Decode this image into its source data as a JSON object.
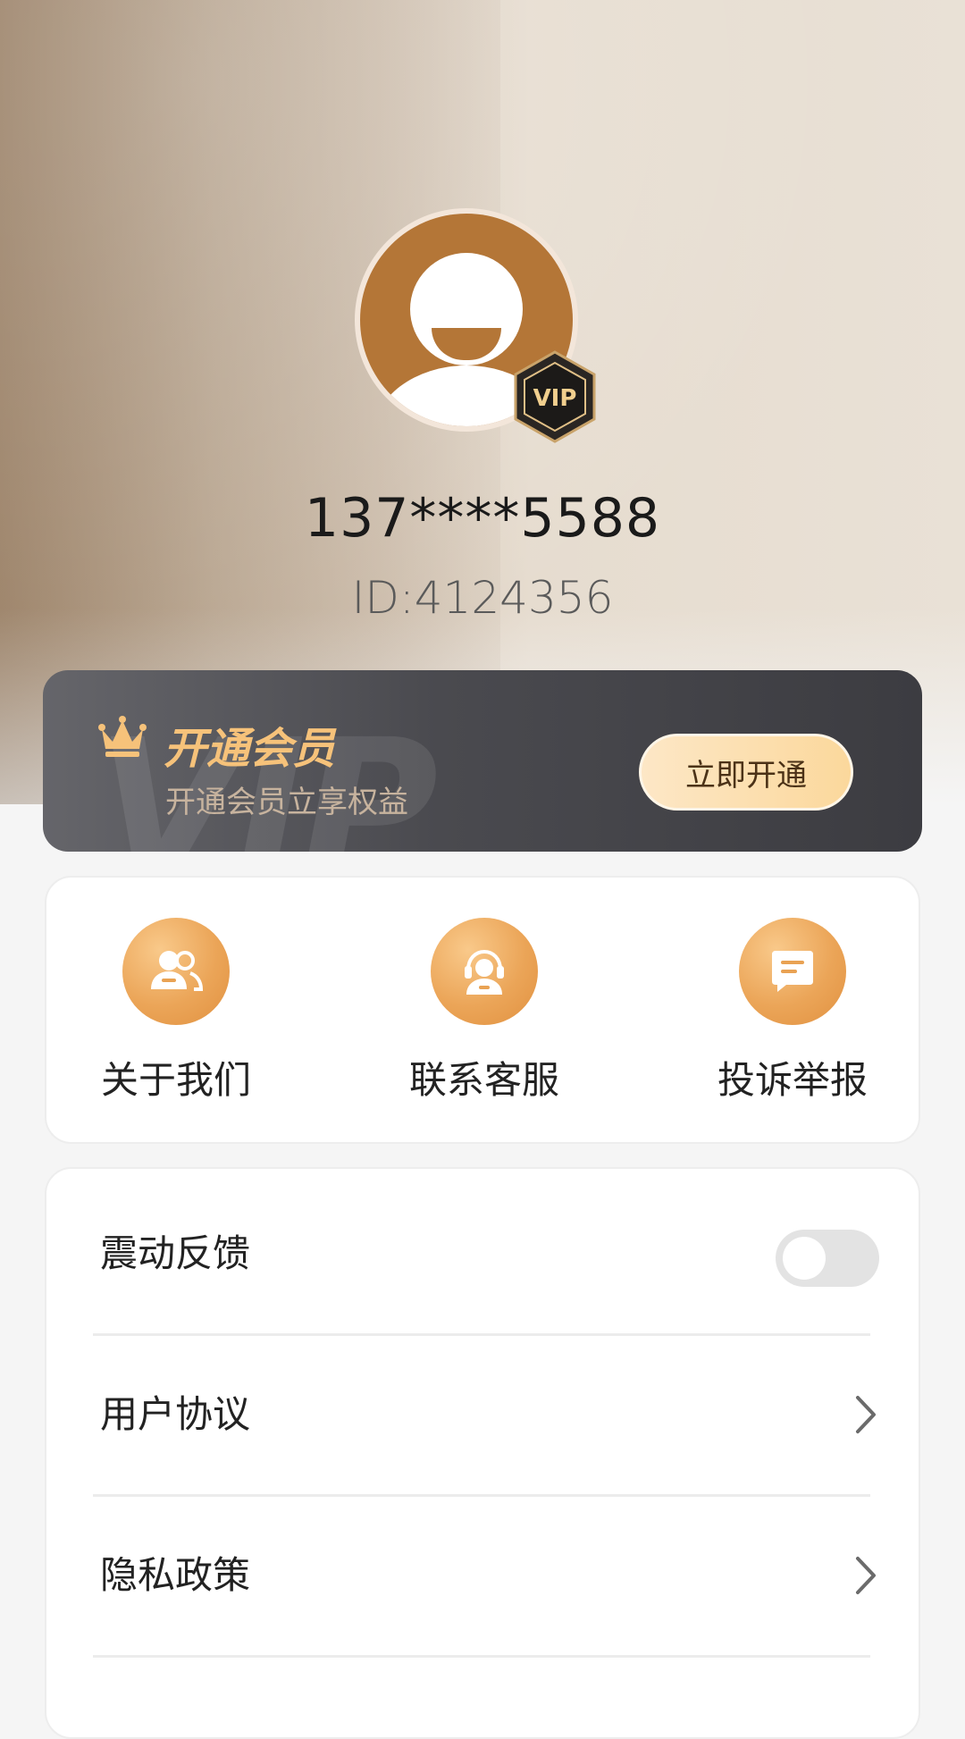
{
  "profile": {
    "phone": "137****5588",
    "id": "ID:4124356",
    "badge": "VIP"
  },
  "vip_banner": {
    "watermark": "VIP",
    "title": "开通会员",
    "subtitle": "开通会员立享权益",
    "button": "立即开通"
  },
  "actions": [
    {
      "label": "关于我们",
      "icon": "users-icon"
    },
    {
      "label": "联系客服",
      "icon": "headset-agent-icon"
    },
    {
      "label": "投诉举报",
      "icon": "message-icon"
    }
  ],
  "settings": [
    {
      "label": "震动反馈",
      "control": "toggle",
      "on": false
    },
    {
      "label": "用户协议",
      "control": "chevron"
    },
    {
      "label": "隐私政策",
      "control": "chevron"
    }
  ],
  "colors": {
    "accent_orange": "#e9a253",
    "avatar_brown": "#b47637",
    "vip_gold": "#f6c27a",
    "banner_dark": "#4a4a4f"
  }
}
